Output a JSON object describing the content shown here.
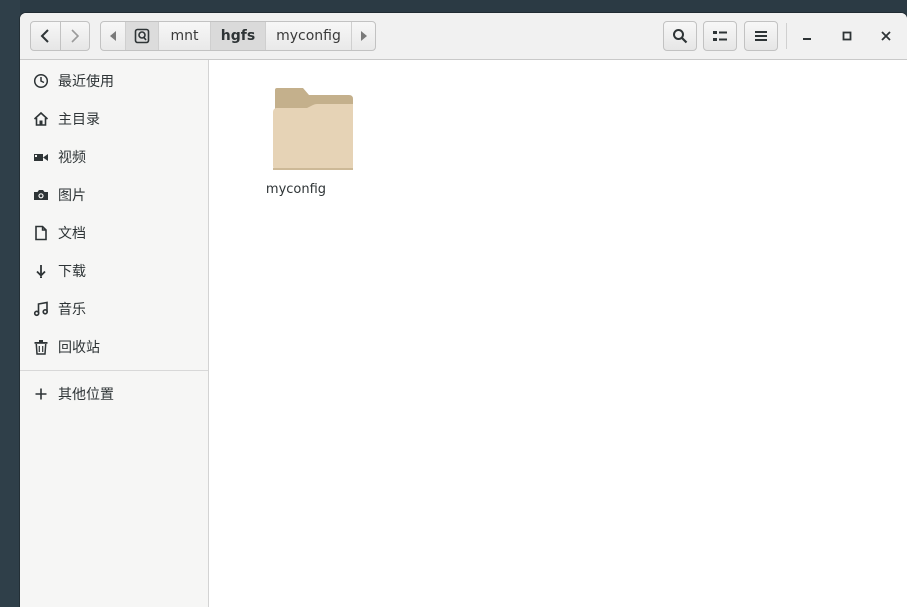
{
  "headerbar": {
    "path_segments": [
      "mnt",
      "hgfs",
      "myconfig"
    ],
    "active_segment": "hgfs"
  },
  "sidebar": {
    "items": [
      {
        "label": "最近使用",
        "icon": "clock-icon"
      },
      {
        "label": "主目录",
        "icon": "home-icon"
      },
      {
        "label": "视频",
        "icon": "video-icon"
      },
      {
        "label": "图片",
        "icon": "camera-icon"
      },
      {
        "label": "文档",
        "icon": "document-icon"
      },
      {
        "label": "下载",
        "icon": "download-icon"
      },
      {
        "label": "音乐",
        "icon": "music-icon"
      },
      {
        "label": "回收站",
        "icon": "trash-icon"
      }
    ],
    "other_locations": {
      "label": "其他位置",
      "icon": "plus-icon"
    }
  },
  "content": {
    "files": [
      {
        "name": "myconfig",
        "type": "folder"
      }
    ]
  },
  "colors": {
    "folder_tab": "#c4b08c",
    "folder_body": "#e6d3b6",
    "sidebar_bg": "#f6f6f5",
    "headerbar_bg": "#f1f1f1"
  }
}
